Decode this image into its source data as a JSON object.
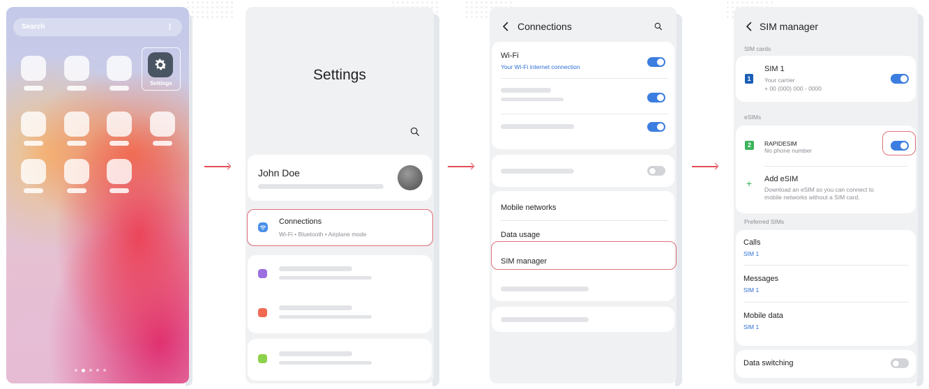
{
  "home": {
    "search_label": "Search",
    "kebab": "⋮",
    "settings_label": "Settings"
  },
  "settings": {
    "title": "Settings",
    "profile_name": "John Doe",
    "connections_title": "Connections",
    "connections_sub": "Wi-Fi  •  Bluetooth  •  Airplane mode"
  },
  "connections": {
    "title": "Connections",
    "wifi_title": "Wi-Fi",
    "wifi_sub": "Your Wi-Fi internet connection",
    "items": [
      "Mobile networks",
      "Data usage",
      "SIM manager"
    ]
  },
  "sim_manager": {
    "title": "SIM manager",
    "sim_cards_header": "SIM cards",
    "sim1_badge": "1",
    "sim1_title": "SIM 1",
    "sim1_carrier": "Your carrier",
    "sim1_number": "+ 00 (000) 000 - 0000",
    "esims_header": "eSIMs",
    "esim_badge": "2",
    "esim_name": "RAPIDESIM",
    "esim_sub": "No phone number",
    "add_esim_icon": "+",
    "add_esim_title": "Add eSIM",
    "add_esim_desc1": "Download an eSIM so you can connect to",
    "add_esim_desc2": "mobile networks without a SIM card.",
    "preferred_header": "Preferred SIMs",
    "preferred": [
      {
        "label": "Calls",
        "value": "SIM 1"
      },
      {
        "label": "Messages",
        "value": "SIM 1"
      },
      {
        "label": "Mobile data",
        "value": "SIM 1"
      }
    ],
    "data_switching": "Data switching"
  },
  "colors": {
    "accent_blue": "#3c7ee0",
    "highlight_red": "#e0707a",
    "arrow_red": "#e24b57"
  },
  "icons": [
    "gear-icon",
    "search-icon",
    "back-chevron-icon",
    "wifi-icon",
    "plus-icon",
    "arrow-right-icon"
  ]
}
